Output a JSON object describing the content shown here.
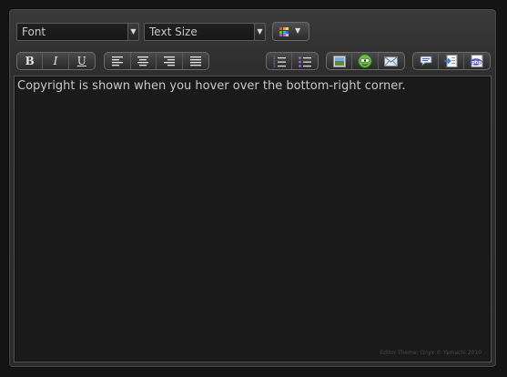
{
  "toolbar": {
    "font_select": {
      "value": "Font"
    },
    "size_select": {
      "value": "Text Size"
    },
    "bold_label": "B",
    "italic_label": "I",
    "underline_label": "U",
    "icons": {
      "color": "color-palette-icon",
      "align_left": "align-left-icon",
      "align_center": "align-center-icon",
      "align_right": "align-right-icon",
      "justify": "align-justify-icon",
      "ordered_list": "ordered-list-icon",
      "unordered_list": "unordered-list-icon",
      "image": "insert-image-icon",
      "emoticon": "emoticon-icon",
      "email": "email-icon",
      "quote": "quote-bubble-icon",
      "code": "code-icon",
      "php": "php-icon"
    }
  },
  "editor": {
    "content": "Copyright is shown when you hover over the bottom-right corner.",
    "credit": "Editor Theme: Onyx © Yamachi 2010"
  },
  "colors": {
    "background": "#141414",
    "panel": "#2e2e2e",
    "text": "#c8c8c8",
    "accent_purple": "#b06be0"
  }
}
